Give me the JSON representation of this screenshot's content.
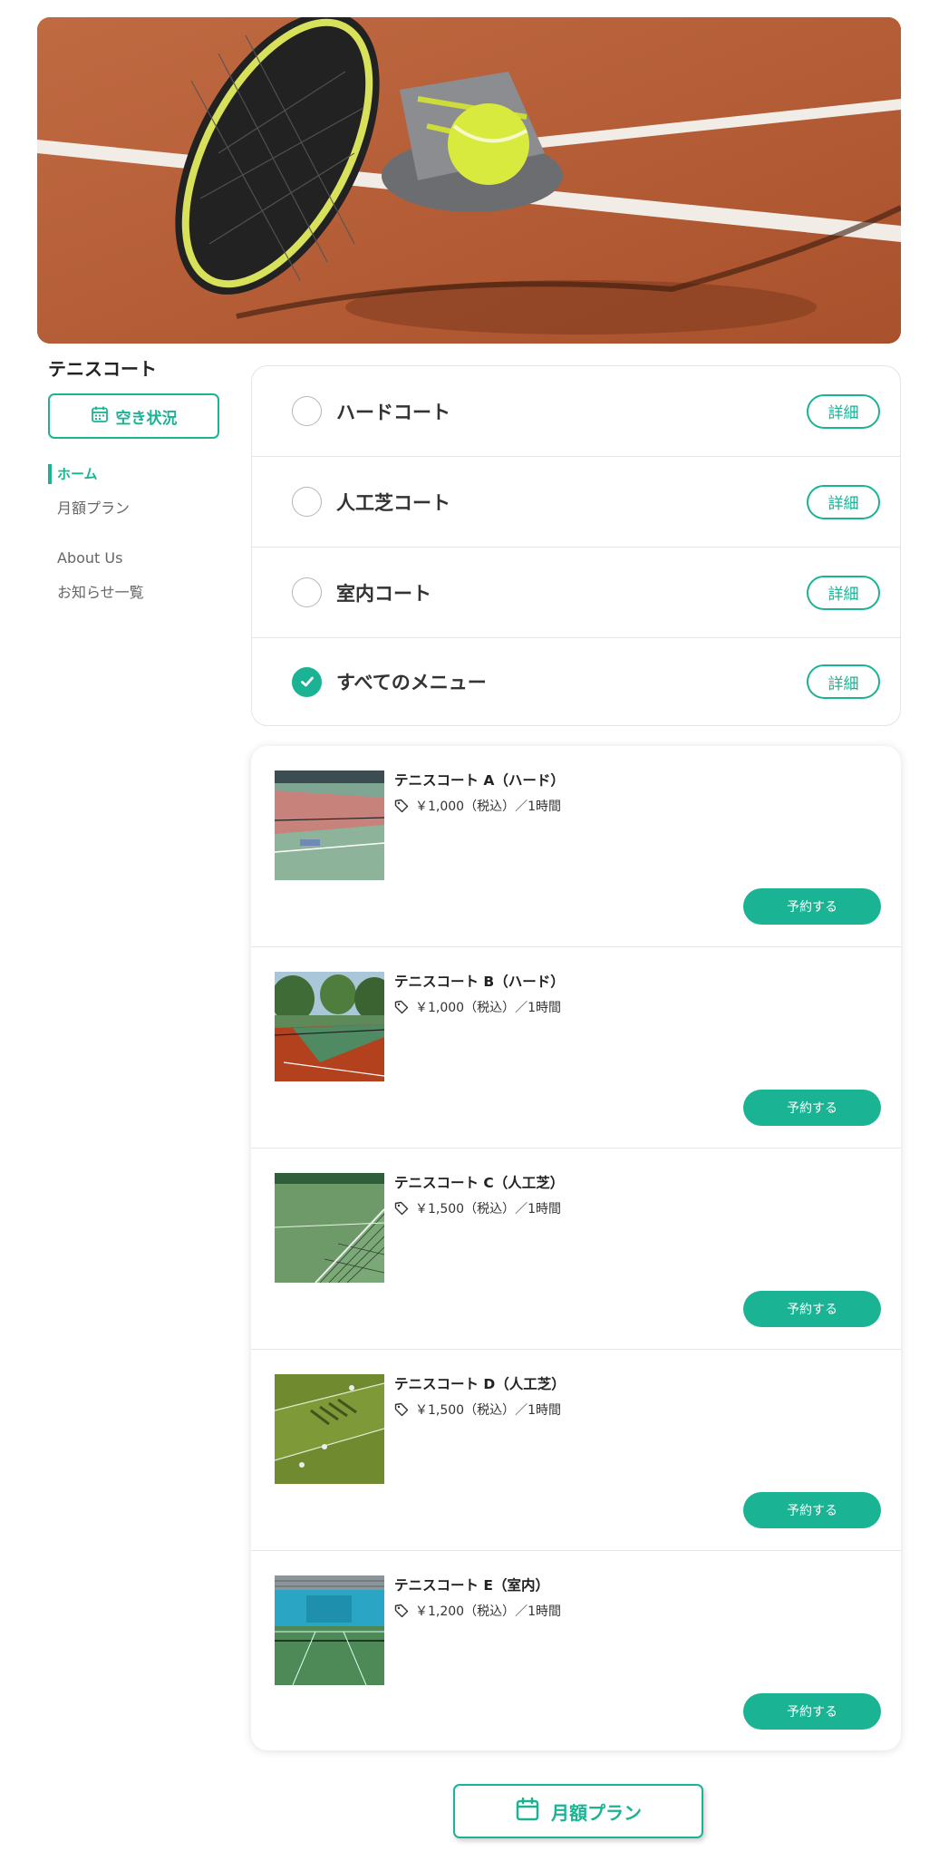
{
  "site": {
    "title": "テニスコート"
  },
  "sidebar": {
    "availability_button": {
      "label": "空き状況",
      "icon": "calendar-icon"
    },
    "nav": [
      {
        "label": "ホーム",
        "active": true
      },
      {
        "label": "月額プラン",
        "active": false
      },
      {
        "label": "About Us",
        "active": false
      },
      {
        "label": "お知らせ一覧",
        "active": false
      }
    ]
  },
  "filters": [
    {
      "label": "ハードコート",
      "checked": false,
      "detail_label": "詳細"
    },
    {
      "label": "人工芝コート",
      "checked": false,
      "detail_label": "詳細"
    },
    {
      "label": "室内コート",
      "checked": false,
      "detail_label": "詳細"
    },
    {
      "label": "すべてのメニュー",
      "checked": true,
      "detail_label": "詳細"
    }
  ],
  "courts": [
    {
      "name": "テニスコート A（ハード）",
      "price": "￥1,000（税込）／1時間",
      "button": "予約する",
      "icon": "price-tag-icon"
    },
    {
      "name": "テニスコート B（ハード）",
      "price": "￥1,000（税込）／1時間",
      "button": "予約する",
      "icon": "price-tag-icon"
    },
    {
      "name": "テニスコート C（人工芝）",
      "price": "￥1,500（税込）／1時間",
      "button": "予約する",
      "icon": "price-tag-icon"
    },
    {
      "name": "テニスコート D（人工芝）",
      "price": "￥1,500（税込）／1時間",
      "button": "予約する",
      "icon": "price-tag-icon"
    },
    {
      "name": "テニスコート E（室内）",
      "price": "￥1,200（税込）／1時間",
      "button": "予約する",
      "icon": "price-tag-icon"
    }
  ],
  "monthly_plan_button": {
    "label": "月額プラン",
    "icon": "calendar-icon"
  },
  "colors": {
    "accent": "#1ab394",
    "text": "#333333",
    "border": "#e4e4e4"
  }
}
